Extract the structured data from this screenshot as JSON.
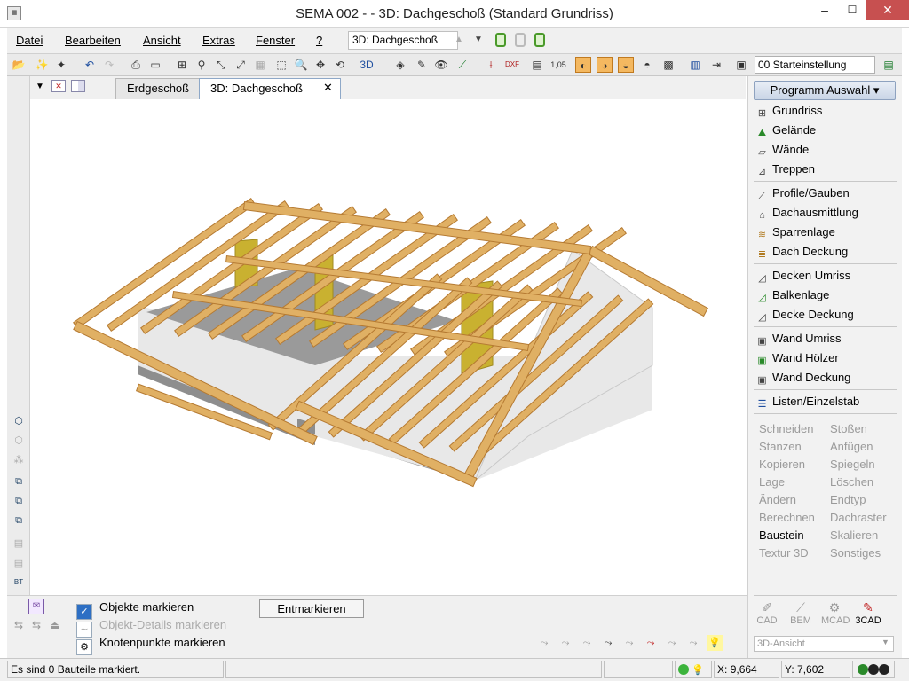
{
  "window": {
    "title": "SEMA  002 -   - 3D: Dachgeschoß (Standard Grundriss)",
    "minimize": "–",
    "maximize": "☐",
    "close": "✕"
  },
  "menu": {
    "items": [
      "Datei",
      "Bearbeiten",
      "Ansicht",
      "Extras",
      "Fenster",
      "?"
    ],
    "view_combo": "3D: Dachgeschoß"
  },
  "toolbar": {
    "settings_combo": "00 Starteinstellung",
    "zoom_label": "1,05"
  },
  "tabs": [
    "Erdgeschoß",
    "3D: Dachgeschoß"
  ],
  "right_panel": {
    "program_button": "Programm Auswahl",
    "groups": [
      [
        "Grundriss",
        "Gelände",
        "Wände",
        "Treppen"
      ],
      [
        "Profile/Gauben",
        "Dachausmittlung",
        "Sparrenlage",
        "Dach Deckung"
      ],
      [
        "Decken Umriss",
        "Balkenlage",
        "Decke Deckung"
      ],
      [
        "Wand Umriss",
        "Wand Hölzer",
        "Wand Deckung"
      ],
      [
        "Listen/Einzelstab"
      ]
    ],
    "commands_left": [
      "Schneiden",
      "Stanzen",
      "Kopieren",
      "Lage",
      "Ändern",
      "Berechnen",
      "Baustein",
      "Textur 3D"
    ],
    "commands_right": [
      "Stoßen",
      "Anfügen",
      "Spiegeln",
      "Löschen",
      "Endtyp",
      "Dachraster",
      "Skalieren",
      "Sonstiges"
    ],
    "active_command": "Baustein",
    "modes": [
      "CAD",
      "BEM",
      "MCAD",
      "3CAD"
    ],
    "active_mode": "3CAD",
    "view_combo": "3D-Ansicht"
  },
  "options": {
    "mark_objects": "Objekte markieren",
    "mark_details": "Objekt-Details markieren",
    "mark_nodes": "Knotenpunkte markieren",
    "unmark_button": "Entmarkieren"
  },
  "status": {
    "message": "Es sind 0 Bauteile markiert.",
    "x_label": "X:",
    "x_value": "9,664",
    "y_label": "Y:",
    "y_value": "7,602"
  },
  "colors": {
    "timber": "#e0b064",
    "timber_dark": "#b57a32",
    "wall": "#e8e8e8",
    "wall_shadow": "#8e8e8e",
    "insulation": "#c9b130",
    "accent": "#1f4fa0"
  }
}
